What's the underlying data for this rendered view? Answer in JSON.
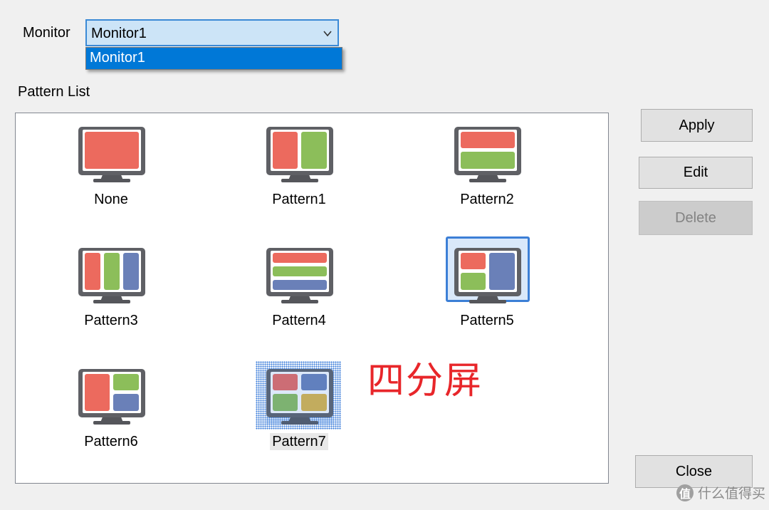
{
  "monitor": {
    "label": "Monitor",
    "selected": "Monitor1",
    "options": [
      "Monitor1"
    ]
  },
  "pattern_list": {
    "label": "Pattern List",
    "patterns": [
      {
        "name": "None",
        "layout": "single"
      },
      {
        "name": "Pattern1",
        "layout": "two-columns"
      },
      {
        "name": "Pattern2",
        "layout": "two-rows"
      },
      {
        "name": "Pattern3",
        "layout": "three-columns"
      },
      {
        "name": "Pattern4",
        "layout": "three-rows"
      },
      {
        "name": "Pattern5",
        "layout": "left-split-right-full",
        "state": "selected"
      },
      {
        "name": "Pattern6",
        "layout": "left-full-right-split"
      },
      {
        "name": "Pattern7",
        "layout": "quad",
        "state": "focused"
      }
    ]
  },
  "annotation": "四分屏",
  "buttons": {
    "apply": "Apply",
    "edit": "Edit",
    "delete": "Delete",
    "close": "Close"
  },
  "watermark": {
    "badge": "值",
    "text": "什么值得买"
  },
  "colors": {
    "zone_red": "#ec6a5e",
    "zone_green": "#8cbe5a",
    "zone_blue": "#6a80b8",
    "zone_yellow": "#e0b642",
    "monitor_frame": "#5f6065",
    "annotation_red": "#e8262a",
    "accent_blue": "#0078d7"
  }
}
